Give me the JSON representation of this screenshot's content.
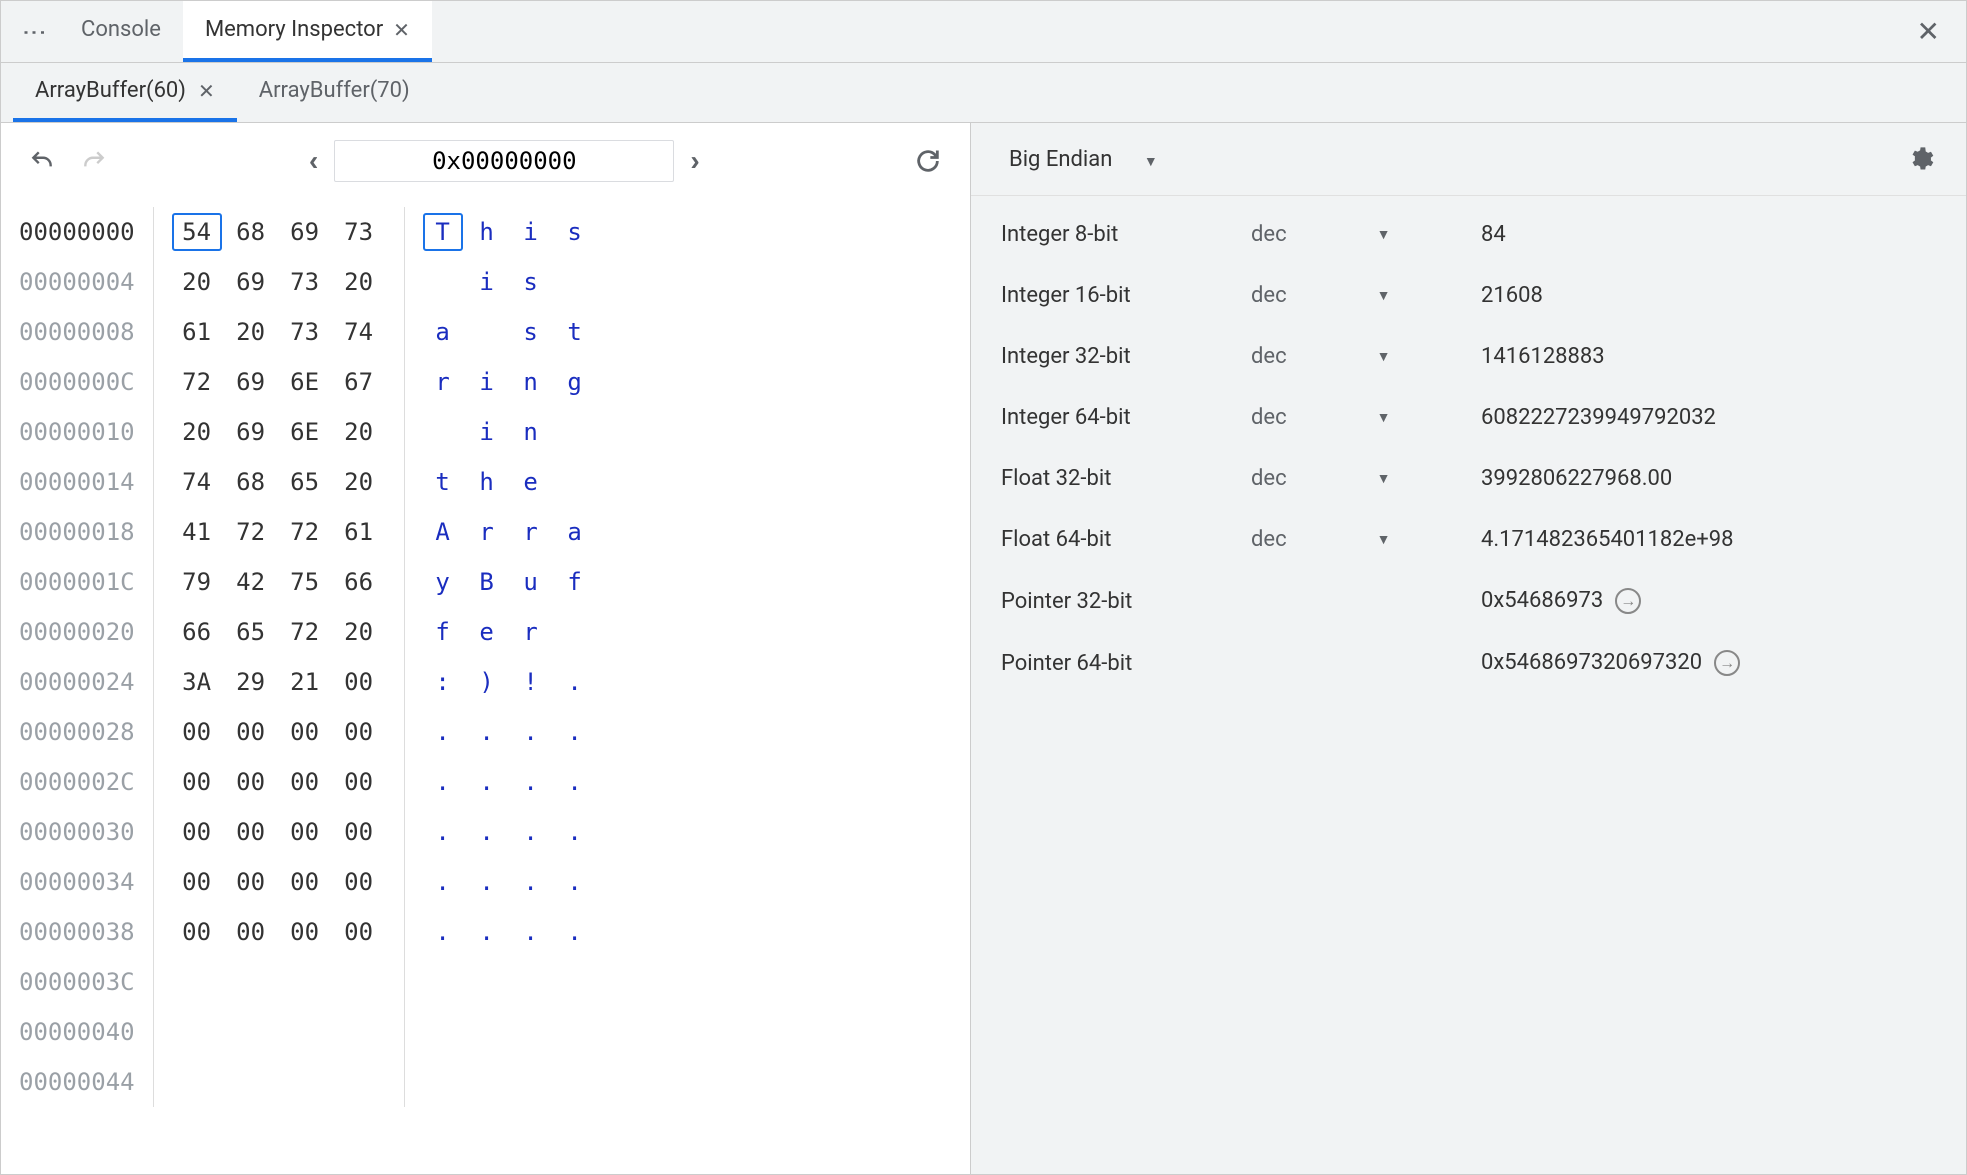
{
  "topTabs": {
    "console": "Console",
    "memoryInspector": "Memory Inspector"
  },
  "subTabs": {
    "buf60": "ArrayBuffer(60)",
    "buf70": "ArrayBuffer(70)"
  },
  "addressInput": "0x00000000",
  "hexRows": [
    {
      "addr": "00000000",
      "bytes": [
        "54",
        "68",
        "69",
        "73"
      ],
      "ascii": [
        "T",
        "h",
        "i",
        "s"
      ],
      "sel": 0
    },
    {
      "addr": "00000004",
      "bytes": [
        "20",
        "69",
        "73",
        "20"
      ],
      "ascii": [
        " ",
        "i",
        "s",
        " "
      ]
    },
    {
      "addr": "00000008",
      "bytes": [
        "61",
        "20",
        "73",
        "74"
      ],
      "ascii": [
        "a",
        " ",
        "s",
        "t"
      ]
    },
    {
      "addr": "0000000C",
      "bytes": [
        "72",
        "69",
        "6E",
        "67"
      ],
      "ascii": [
        "r",
        "i",
        "n",
        "g"
      ]
    },
    {
      "addr": "00000010",
      "bytes": [
        "20",
        "69",
        "6E",
        "20"
      ],
      "ascii": [
        " ",
        "i",
        "n",
        " "
      ]
    },
    {
      "addr": "00000014",
      "bytes": [
        "74",
        "68",
        "65",
        "20"
      ],
      "ascii": [
        "t",
        "h",
        "e",
        " "
      ]
    },
    {
      "addr": "00000018",
      "bytes": [
        "41",
        "72",
        "72",
        "61"
      ],
      "ascii": [
        "A",
        "r",
        "r",
        "a"
      ]
    },
    {
      "addr": "0000001C",
      "bytes": [
        "79",
        "42",
        "75",
        "66"
      ],
      "ascii": [
        "y",
        "B",
        "u",
        "f"
      ]
    },
    {
      "addr": "00000020",
      "bytes": [
        "66",
        "65",
        "72",
        "20"
      ],
      "ascii": [
        "f",
        "e",
        "r",
        " "
      ]
    },
    {
      "addr": "00000024",
      "bytes": [
        "3A",
        "29",
        "21",
        "00"
      ],
      "ascii": [
        ":",
        ")",
        "!",
        "."
      ]
    },
    {
      "addr": "00000028",
      "bytes": [
        "00",
        "00",
        "00",
        "00"
      ],
      "ascii": [
        ".",
        ".",
        ".",
        "."
      ]
    },
    {
      "addr": "0000002C",
      "bytes": [
        "00",
        "00",
        "00",
        "00"
      ],
      "ascii": [
        ".",
        ".",
        ".",
        "."
      ]
    },
    {
      "addr": "00000030",
      "bytes": [
        "00",
        "00",
        "00",
        "00"
      ],
      "ascii": [
        ".",
        ".",
        ".",
        "."
      ]
    },
    {
      "addr": "00000034",
      "bytes": [
        "00",
        "00",
        "00",
        "00"
      ],
      "ascii": [
        ".",
        ".",
        ".",
        "."
      ]
    },
    {
      "addr": "00000038",
      "bytes": [
        "00",
        "00",
        "00",
        "00"
      ],
      "ascii": [
        ".",
        ".",
        ".",
        "."
      ]
    },
    {
      "addr": "0000003C",
      "bytes": [],
      "ascii": []
    },
    {
      "addr": "00000040",
      "bytes": [],
      "ascii": []
    },
    {
      "addr": "00000044",
      "bytes": [],
      "ascii": []
    }
  ],
  "endian": "Big Endian",
  "interpretations": [
    {
      "label": "Integer 8-bit",
      "mode": "dec",
      "value": "84"
    },
    {
      "label": "Integer 16-bit",
      "mode": "dec",
      "value": "21608"
    },
    {
      "label": "Integer 32-bit",
      "mode": "dec",
      "value": "1416128883"
    },
    {
      "label": "Integer 64-bit",
      "mode": "dec",
      "value": "6082227239949792032"
    },
    {
      "label": "Float 32-bit",
      "mode": "dec",
      "value": "3992806227968.00"
    },
    {
      "label": "Float 64-bit",
      "mode": "dec",
      "value": "4.171482365401182e+98"
    },
    {
      "label": "Pointer 32-bit",
      "mode": "",
      "value": "0x54686973",
      "jump": true
    },
    {
      "label": "Pointer 64-bit",
      "mode": "",
      "value": "0x5468697320697320",
      "jump": true
    }
  ]
}
